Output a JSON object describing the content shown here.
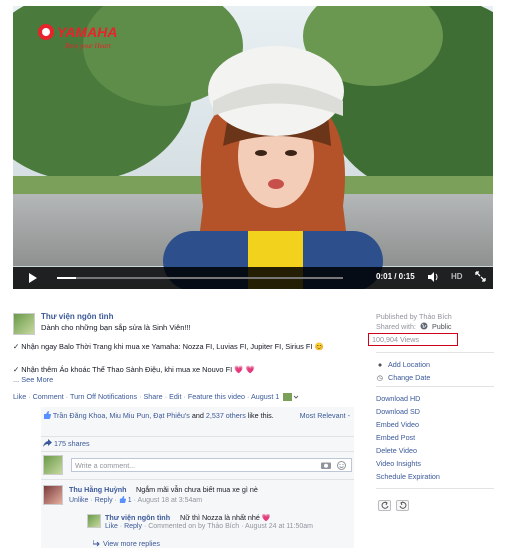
{
  "video": {
    "brand": "YAMAHA",
    "brand_tagline": "Revs your Heart",
    "time": "0:01 / 0:15",
    "hd": "HD",
    "progress_fraction": 0.067
  },
  "post": {
    "page_name": "Thư viện ngôn tình",
    "tagline": "Dành cho những bạn sắp sửa là Sinh Viên!!!",
    "line1": "✓ Nhận ngay Balo Thời Trang khi mua xe Yamaha: Nozza FI, Luvias FI, Jupiter FI, Sirius FI 😊",
    "line2": "✓ Nhận thêm Áo khoác Thể Thao Sành Điệu, khi mua xe Nouvo FI 💗 💗",
    "see_more": "... See More",
    "actions": {
      "like": "Like",
      "comment": "Comment",
      "turn_off": "Turn Off Notifications",
      "share": "Share",
      "edit": "Edit",
      "feature": "Feature this video",
      "date": "August 1"
    }
  },
  "engagement": {
    "likers": "Trần Đăng Khoa, Miu Miu Pun, Đạt Phiêu's",
    "likers_and": "and",
    "others": "2,537 others",
    "like_this": "like this.",
    "most_relevant": "Most Relevant -",
    "shares": "175 shares",
    "comment_placeholder": "Write a comment..."
  },
  "comments": [
    {
      "name": "Thu Hằng Huỳnh",
      "text": "Ngắm mãi vẫn chưa biết mua xe gì nè",
      "unlike": "Unlike",
      "reply": "Reply",
      "likes": "1",
      "time": "August 18 at 3:54am"
    },
    {
      "name": "Thư viện ngôn tình",
      "text": "Nữ thì Nozza là nhất nhé 💗",
      "like": "Like",
      "reply": "Reply",
      "commented_by": "Commented on by Thảo Bích",
      "time": "August 24 at 11:50am"
    }
  ],
  "view_more_replies": "View more replies",
  "sidebar": {
    "published_by": "Published by Thảo Bích",
    "shared_with_label": "Shared with:",
    "shared_with_value": "Public",
    "views": "100,904 Views",
    "add_location": "Add Location",
    "change_date": "Change Date",
    "links": [
      "Download HD",
      "Download SD",
      "Embed Video",
      "Embed Post",
      "Delete Video",
      "Video Insights",
      "Schedule Expiration"
    ]
  }
}
